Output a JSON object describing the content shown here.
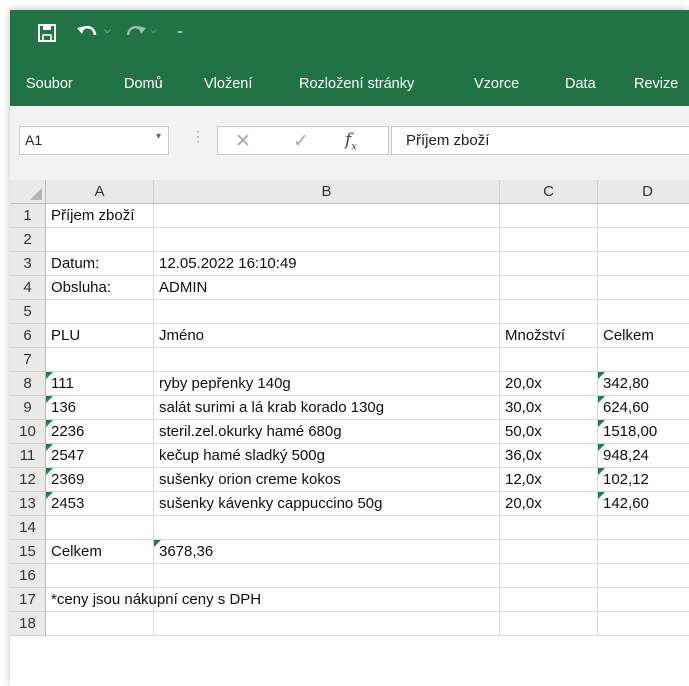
{
  "ribbon_tabs": [
    "Soubor",
    "Domů",
    "Vložení",
    "Rozložení stránky",
    "Vzorce",
    "Data",
    "Revize"
  ],
  "name_box": "A1",
  "formula_value": "Příjem zboží",
  "columns": [
    "A",
    "B",
    "C",
    "D"
  ],
  "rows": [
    {
      "n": "1",
      "a": "Příjem zboží",
      "b": "",
      "c": "",
      "d": ""
    },
    {
      "n": "2",
      "a": "",
      "b": "",
      "c": "",
      "d": ""
    },
    {
      "n": "3",
      "a": "Datum:",
      "b": "12.05.2022 16:10:49",
      "c": "",
      "d": ""
    },
    {
      "n": "4",
      "a": "Obsluha:",
      "b": "ADMIN",
      "c": "",
      "d": ""
    },
    {
      "n": "5",
      "a": "",
      "b": "",
      "c": "",
      "d": ""
    },
    {
      "n": "6",
      "a": "PLU",
      "b": "Jméno",
      "c": "Množství",
      "d": "Celkem"
    },
    {
      "n": "7",
      "a": "",
      "b": "",
      "c": "",
      "d": ""
    },
    {
      "n": "8",
      "a": "111",
      "b": "ryby pepřenky 140g",
      "c": "20,0x",
      "d": "342,80"
    },
    {
      "n": "9",
      "a": "136",
      "b": "salát surimi a lá krab korado 130g",
      "c": "30,0x",
      "d": "624,60"
    },
    {
      "n": "10",
      "a": "2236",
      "b": "steril.zel.okurky hamé 680g",
      "c": "50,0x",
      "d": "1518,00"
    },
    {
      "n": "11",
      "a": "2547",
      "b": "kečup hamé sladký 500g",
      "c": "36,0x",
      "d": "948,24"
    },
    {
      "n": "12",
      "a": "2369",
      "b": "sušenky orion creme kokos",
      "c": "12,0x",
      "d": "102,12"
    },
    {
      "n": "13",
      "a": "2453",
      "b": "sušenky kávenky cappuccino 50g",
      "c": "20,0x",
      "d": "142,60"
    },
    {
      "n": "14",
      "a": "",
      "b": "",
      "c": "",
      "d": ""
    },
    {
      "n": "15",
      "a": "Celkem",
      "b": "3678,36",
      "c": "",
      "d": ""
    },
    {
      "n": "16",
      "a": "",
      "b": "",
      "c": "",
      "d": ""
    },
    {
      "n": "17",
      "a": "*ceny jsou nákupní ceny s DPH",
      "b": "",
      "c": "",
      "d": ""
    },
    {
      "n": "18",
      "a": "",
      "b": "",
      "c": "",
      "d": ""
    }
  ],
  "colors": {
    "ribbon": "#217346",
    "triangle": "#1e7d3c"
  }
}
